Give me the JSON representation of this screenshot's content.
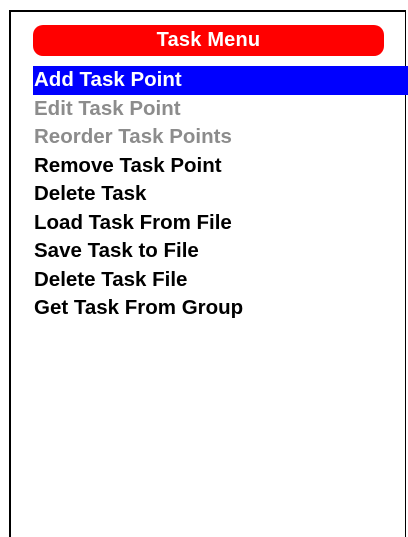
{
  "title": {
    "label": "Task Menu"
  },
  "menu": {
    "items": [
      {
        "label": "Add Task Point",
        "state": "selected"
      },
      {
        "label": "Edit Task Point",
        "state": "disabled"
      },
      {
        "label": "Reorder Task Points",
        "state": "disabled"
      },
      {
        "label": "Remove Task Point",
        "state": "enabled"
      },
      {
        "label": "Delete Task",
        "state": "enabled"
      },
      {
        "label": "Load Task From File",
        "state": "enabled"
      },
      {
        "label": "Save Task to File",
        "state": "enabled"
      },
      {
        "label": "Delete Task File",
        "state": "enabled"
      },
      {
        "label": "Get Task From Group",
        "state": "enabled"
      }
    ]
  },
  "colors": {
    "title_bg": "#ff0000",
    "title_text": "#ffffff",
    "selected_bg": "#0000ff",
    "selected_text": "#ffffff",
    "enabled_text": "#000000",
    "disabled_text": "#8c8c8c"
  }
}
